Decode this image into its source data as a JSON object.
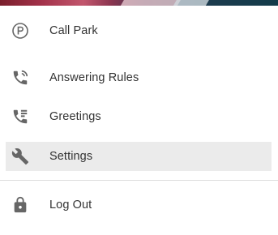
{
  "colors": {
    "active_background": "#ebebeb",
    "icon": "#666666",
    "text": "#333333",
    "divider": "#dcdcdc"
  },
  "menu": {
    "items": [
      {
        "label": "Call Park",
        "icon": "parking-icon",
        "active": false
      },
      {
        "label": "Answering Rules",
        "icon": "phone-forward-icon",
        "active": false
      },
      {
        "label": "Greetings",
        "icon": "phone-greeting-icon",
        "active": false
      },
      {
        "label": "Settings",
        "icon": "wrench-icon",
        "active": true
      },
      {
        "label": "Log Out",
        "icon": "lock-icon",
        "active": false
      }
    ]
  }
}
